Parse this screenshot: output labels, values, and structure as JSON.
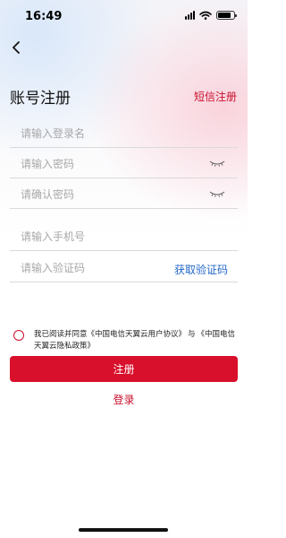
{
  "status_bar": {
    "time": "16:49",
    "battery_level": 0.85
  },
  "header": {
    "title": "账号注册",
    "sms_register_label": "短信注册"
  },
  "form": {
    "username_placeholder": "请输入登录名",
    "password_placeholder": "请输入密码",
    "confirm_password_placeholder": "请确认密码",
    "phone_placeholder": "请输入手机号",
    "code_placeholder": "请输入验证码",
    "get_code_label": "获取验证码"
  },
  "agreement": {
    "prefix": "我已阅读并同意",
    "user_agreement": "《中国电信天翼云用户协议》",
    "conjunction": "与",
    "privacy_policy": "《中国电信天翼云隐私政策》"
  },
  "actions": {
    "register_label": "注册",
    "login_label": "登录"
  },
  "colors": {
    "accent": "#d8102b",
    "link_blue": "#2468c9",
    "placeholder": "#a8a8a8"
  },
  "icons": [
    "back-icon",
    "signal-icon",
    "wifi-icon",
    "battery-icon",
    "eye-closed-icon",
    "radio-unchecked-icon"
  ]
}
